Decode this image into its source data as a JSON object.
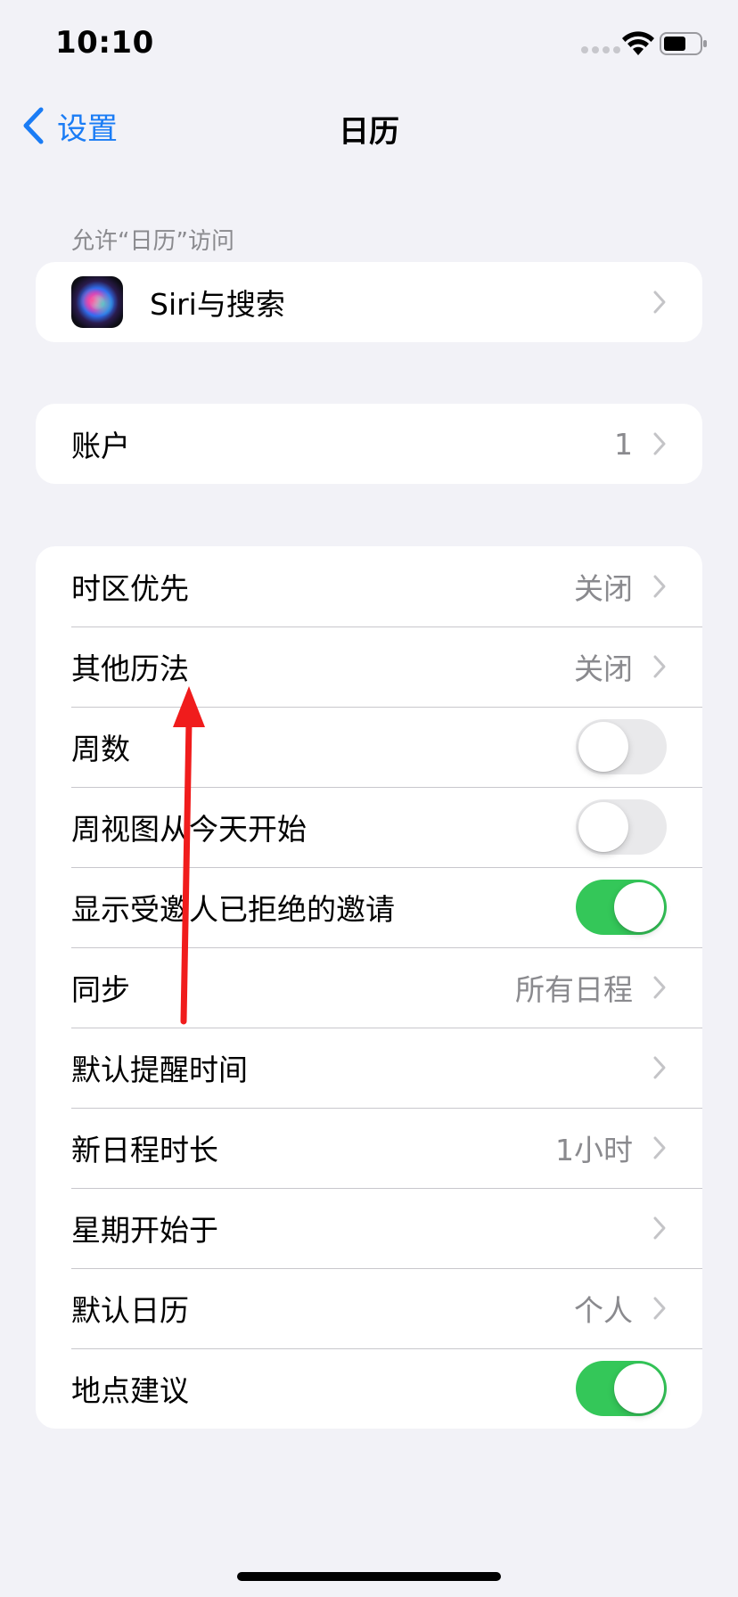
{
  "status_bar": {
    "time": "10:10"
  },
  "nav": {
    "back_label": "设置",
    "title": "日历"
  },
  "section_allow": {
    "header": "允许“日历”访问"
  },
  "siri_row": {
    "label": "Siri与搜索"
  },
  "accounts_row": {
    "label": "账户",
    "value": "1"
  },
  "settings": {
    "time_zone_override": {
      "label": "时区优先",
      "value": "关闭"
    },
    "alternate_calendars": {
      "label": "其他历法",
      "value": "关闭"
    },
    "week_numbers": {
      "label": "周数",
      "on": false
    },
    "week_view_starts_today": {
      "label": "周视图从今天开始",
      "on": false
    },
    "show_declined": {
      "label": "显示受邀人已拒绝的邀请",
      "on": true
    },
    "sync": {
      "label": "同步",
      "value": "所有日程"
    },
    "default_alert_times": {
      "label": "默认提醒时间",
      "value": ""
    },
    "new_event_duration": {
      "label": "新日程时长",
      "value": "1小时"
    },
    "start_week_on": {
      "label": "星期开始于",
      "value": ""
    },
    "default_calendar": {
      "label": "默认日历",
      "value": "个人"
    },
    "location_suggestions": {
      "label": "地点建议",
      "on": true
    }
  },
  "colors": {
    "accent": "#1a7cf5",
    "toggle_on": "#34c759",
    "annotation": "#f01c1c"
  },
  "icons": [
    "wifi-icon",
    "battery-icon",
    "back-chevron-icon",
    "siri-icon",
    "chevron-right-icon",
    "annotation-arrow"
  ]
}
